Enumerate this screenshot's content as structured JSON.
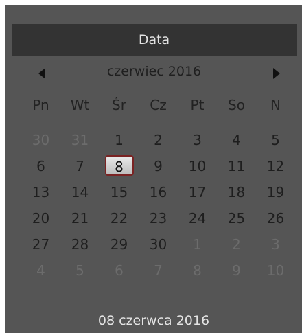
{
  "header": {
    "title": "Data"
  },
  "nav": {
    "month_label": "czerwiec 2016",
    "prev_icon": "triangle-left-icon",
    "next_icon": "triangle-right-icon"
  },
  "weekdays": [
    "Pn",
    "Wt",
    "Śr",
    "Cz",
    "Pt",
    "So",
    "N"
  ],
  "days": [
    {
      "label": "30",
      "muted": true
    },
    {
      "label": "31",
      "muted": true
    },
    {
      "label": "1"
    },
    {
      "label": "2"
    },
    {
      "label": "3"
    },
    {
      "label": "4"
    },
    {
      "label": "5"
    },
    {
      "label": "6"
    },
    {
      "label": "7"
    },
    {
      "label": "8",
      "selected": true
    },
    {
      "label": "9"
    },
    {
      "label": "10"
    },
    {
      "label": "11"
    },
    {
      "label": "12"
    },
    {
      "label": "13"
    },
    {
      "label": "14"
    },
    {
      "label": "15"
    },
    {
      "label": "16"
    },
    {
      "label": "17"
    },
    {
      "label": "18"
    },
    {
      "label": "19"
    },
    {
      "label": "20"
    },
    {
      "label": "21"
    },
    {
      "label": "22"
    },
    {
      "label": "23"
    },
    {
      "label": "24"
    },
    {
      "label": "25"
    },
    {
      "label": "26"
    },
    {
      "label": "27"
    },
    {
      "label": "28"
    },
    {
      "label": "29"
    },
    {
      "label": "30"
    },
    {
      "label": "1",
      "muted": true
    },
    {
      "label": "2",
      "muted": true
    },
    {
      "label": "3",
      "muted": true
    },
    {
      "label": "4",
      "muted": true
    },
    {
      "label": "5",
      "muted": true
    },
    {
      "label": "6",
      "muted": true
    },
    {
      "label": "7",
      "muted": true
    },
    {
      "label": "8",
      "muted": true
    },
    {
      "label": "9",
      "muted": true
    },
    {
      "label": "10",
      "muted": true
    }
  ],
  "footer": {
    "selected_date": "08 czerwca 2016"
  },
  "colors": {
    "background": "#555555",
    "header_bar": "#333333",
    "text_light": "#e4e4e4",
    "text_dark": "#1e1e1e",
    "text_muted": "#6c6c6c",
    "selected_border": "#7a2323"
  }
}
